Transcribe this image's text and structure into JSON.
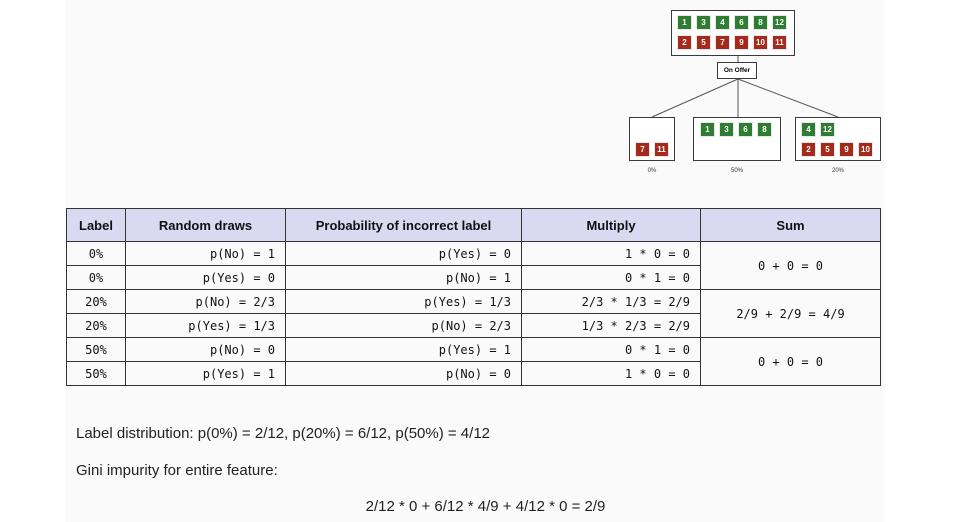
{
  "tree": {
    "root": {
      "green": [
        "1",
        "3",
        "4",
        "6",
        "8",
        "12"
      ],
      "red": [
        "2",
        "5",
        "7",
        "9",
        "10",
        "11"
      ]
    },
    "split_label": "On Offer",
    "children": [
      {
        "green": [],
        "red": [
          "7",
          "11"
        ],
        "pct": "0%"
      },
      {
        "green": [
          "1",
          "3",
          "6",
          "8"
        ],
        "red": [],
        "pct": "50%"
      },
      {
        "green": [
          "4",
          "12"
        ],
        "red": [
          "2",
          "5",
          "9",
          "10"
        ],
        "pct": "20%"
      }
    ],
    "colors": {
      "green": "#2e7d32",
      "red": "#a62a1c"
    }
  },
  "table": {
    "headers": [
      "Label",
      "Random draws",
      "Probability of incorrect label",
      "Multiply",
      "Sum"
    ],
    "rows": [
      [
        "0%",
        "p(No) = 1",
        "p(Yes) = 0",
        "1 * 0 = 0"
      ],
      [
        "0%",
        "p(Yes) = 0",
        "p(No) = 1",
        "0 * 1 = 0"
      ],
      [
        "20%",
        "p(No) = 2/3",
        "p(Yes) = 1/3",
        "2/3 * 1/3 = 2/9"
      ],
      [
        "20%",
        "p(Yes) = 1/3",
        "p(No) = 2/3",
        "1/3 * 2/3 = 2/9"
      ],
      [
        "50%",
        "p(No) = 0",
        "p(Yes) = 1",
        "0 * 1 = 0"
      ],
      [
        "50%",
        "p(Yes) = 1",
        "p(No) = 0",
        "1 * 0 = 0"
      ]
    ],
    "sums": [
      "0 + 0 = 0",
      "2/9 + 2/9 = 4/9",
      "0 + 0 = 0"
    ],
    "header_bg": "#d9d9f2"
  },
  "text": {
    "distribution": "Label distribution: p(0%) = 2/12, p(20%) = 6/12, p(50%) = 4/12",
    "gini_heading": "Gini impurity for entire feature:",
    "formula": "2/12 * 0 + 6/12 * 4/9 + 4/12 * 0 = 2/9"
  }
}
